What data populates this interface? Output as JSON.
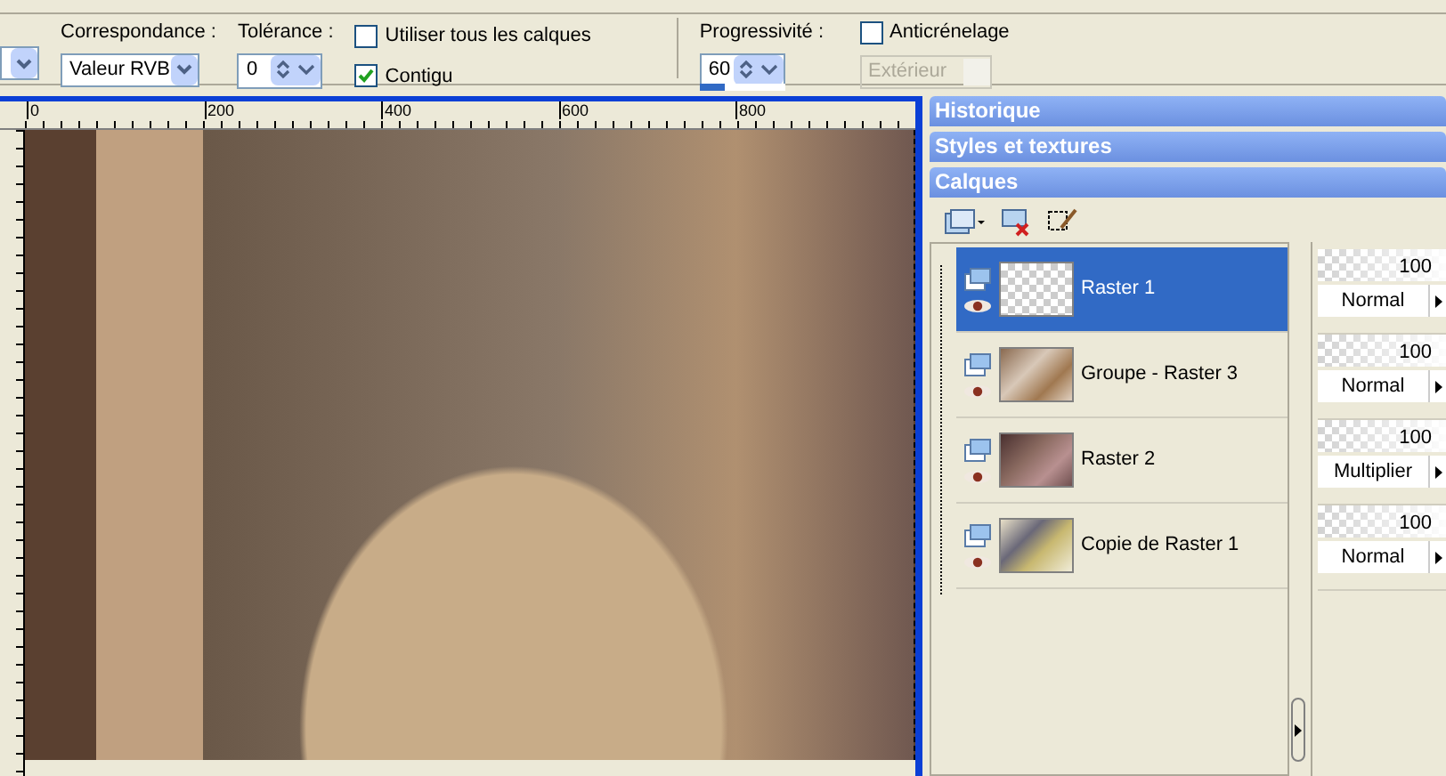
{
  "toolbar": {
    "match": {
      "label": "Correspondance :",
      "value": "Valeur RVB"
    },
    "tolerance": {
      "label": "Tolérance :",
      "value": "0"
    },
    "use_all_layers": {
      "label": "Utiliser tous les calques",
      "checked": false
    },
    "contiguous": {
      "label": "Contigu",
      "checked": true
    },
    "progressivity": {
      "label": "Progressivité :",
      "value": "60",
      "level": 0.3
    },
    "antialias": {
      "label": "Anticrénelage",
      "checked": false
    },
    "antialias_mode": {
      "value": "Extérieur",
      "disabled": true
    }
  },
  "ruler": {
    "labels": [
      "0",
      "200",
      "400",
      "600",
      "800"
    ]
  },
  "palettes": [
    {
      "title": "Historique"
    },
    {
      "title": "Styles et textures"
    },
    {
      "title": "Calques"
    }
  ],
  "layers": [
    {
      "name": "Raster 1",
      "selected": true,
      "opacity": "100",
      "level": 1,
      "blend": "Normal"
    },
    {
      "name": "Groupe - Raster 3",
      "selected": false,
      "opacity": "100",
      "level": 1,
      "blend": "Normal"
    },
    {
      "name": "Raster 2",
      "selected": false,
      "opacity": "100",
      "level": 1,
      "blend": "Multiplier"
    },
    {
      "name": "Copie de Raster 1",
      "selected": false,
      "opacity": "100",
      "level": 1,
      "blend": "Normal"
    }
  ]
}
